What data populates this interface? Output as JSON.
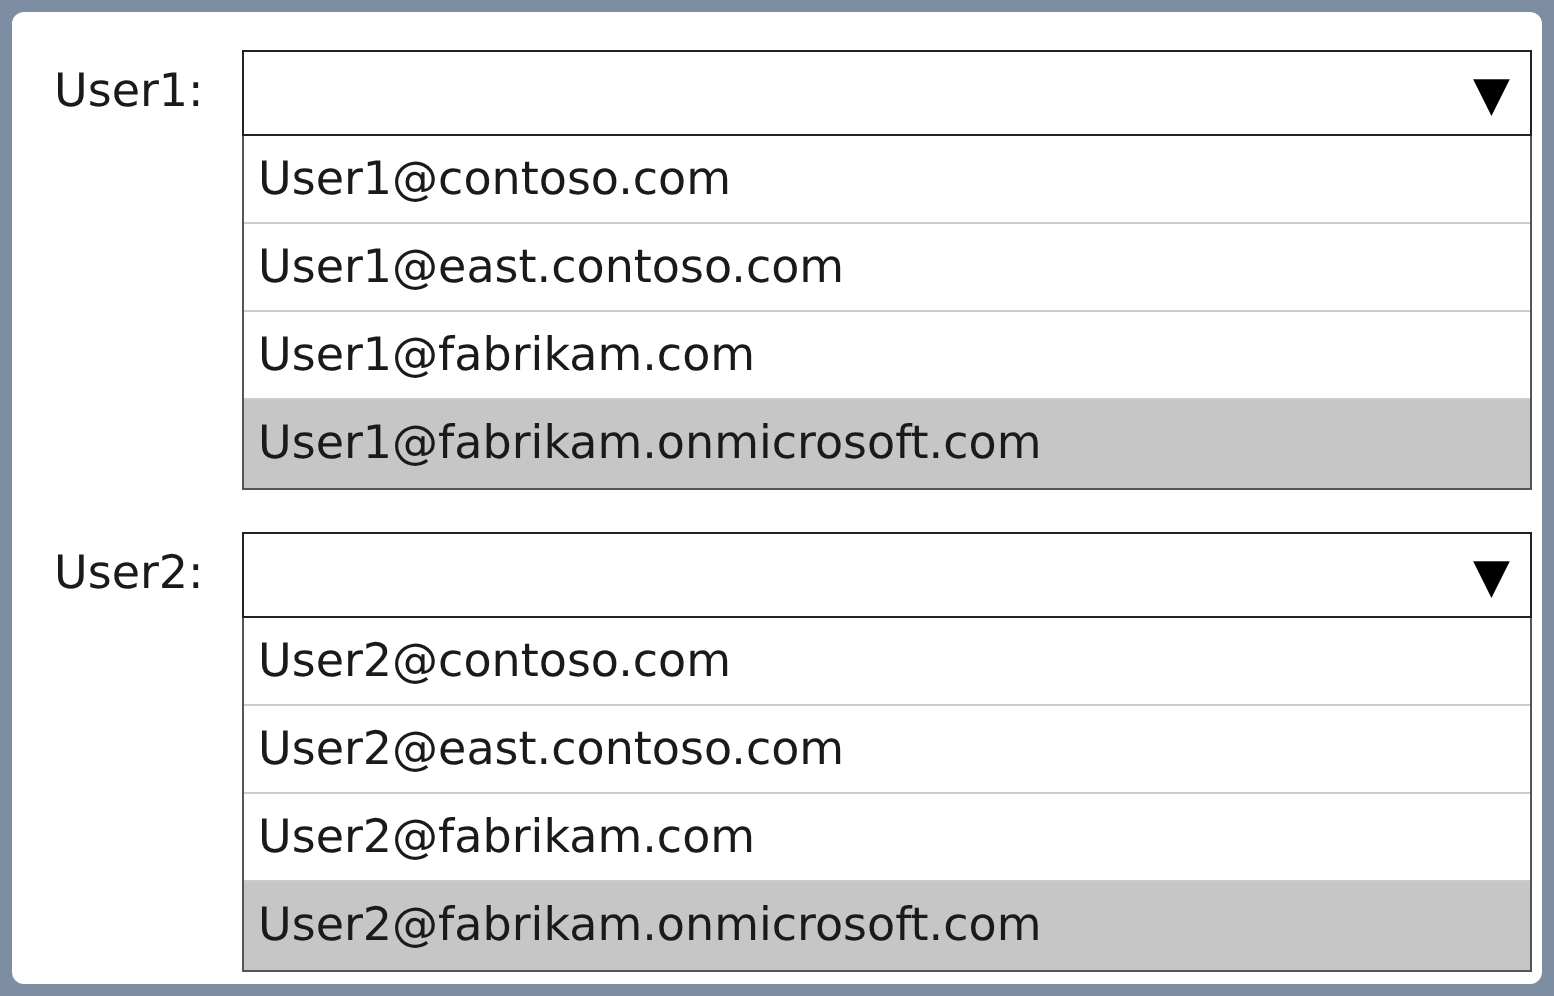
{
  "dropdowns": [
    {
      "label": "User1:",
      "arrow": "▼",
      "options": [
        {
          "text": "User1@contoso.com",
          "selected": false
        },
        {
          "text": "User1@east.contoso.com",
          "selected": false
        },
        {
          "text": "User1@fabrikam.com",
          "selected": false
        },
        {
          "text": "User1@fabrikam.onmicrosoft.com",
          "selected": true
        }
      ]
    },
    {
      "label": "User2:",
      "arrow": "▼",
      "options": [
        {
          "text": "User2@contoso.com",
          "selected": false
        },
        {
          "text": "User2@east.contoso.com",
          "selected": false
        },
        {
          "text": "User2@fabrikam.com",
          "selected": false
        },
        {
          "text": "User2@fabrikam.onmicrosoft.com",
          "selected": true
        }
      ]
    }
  ]
}
